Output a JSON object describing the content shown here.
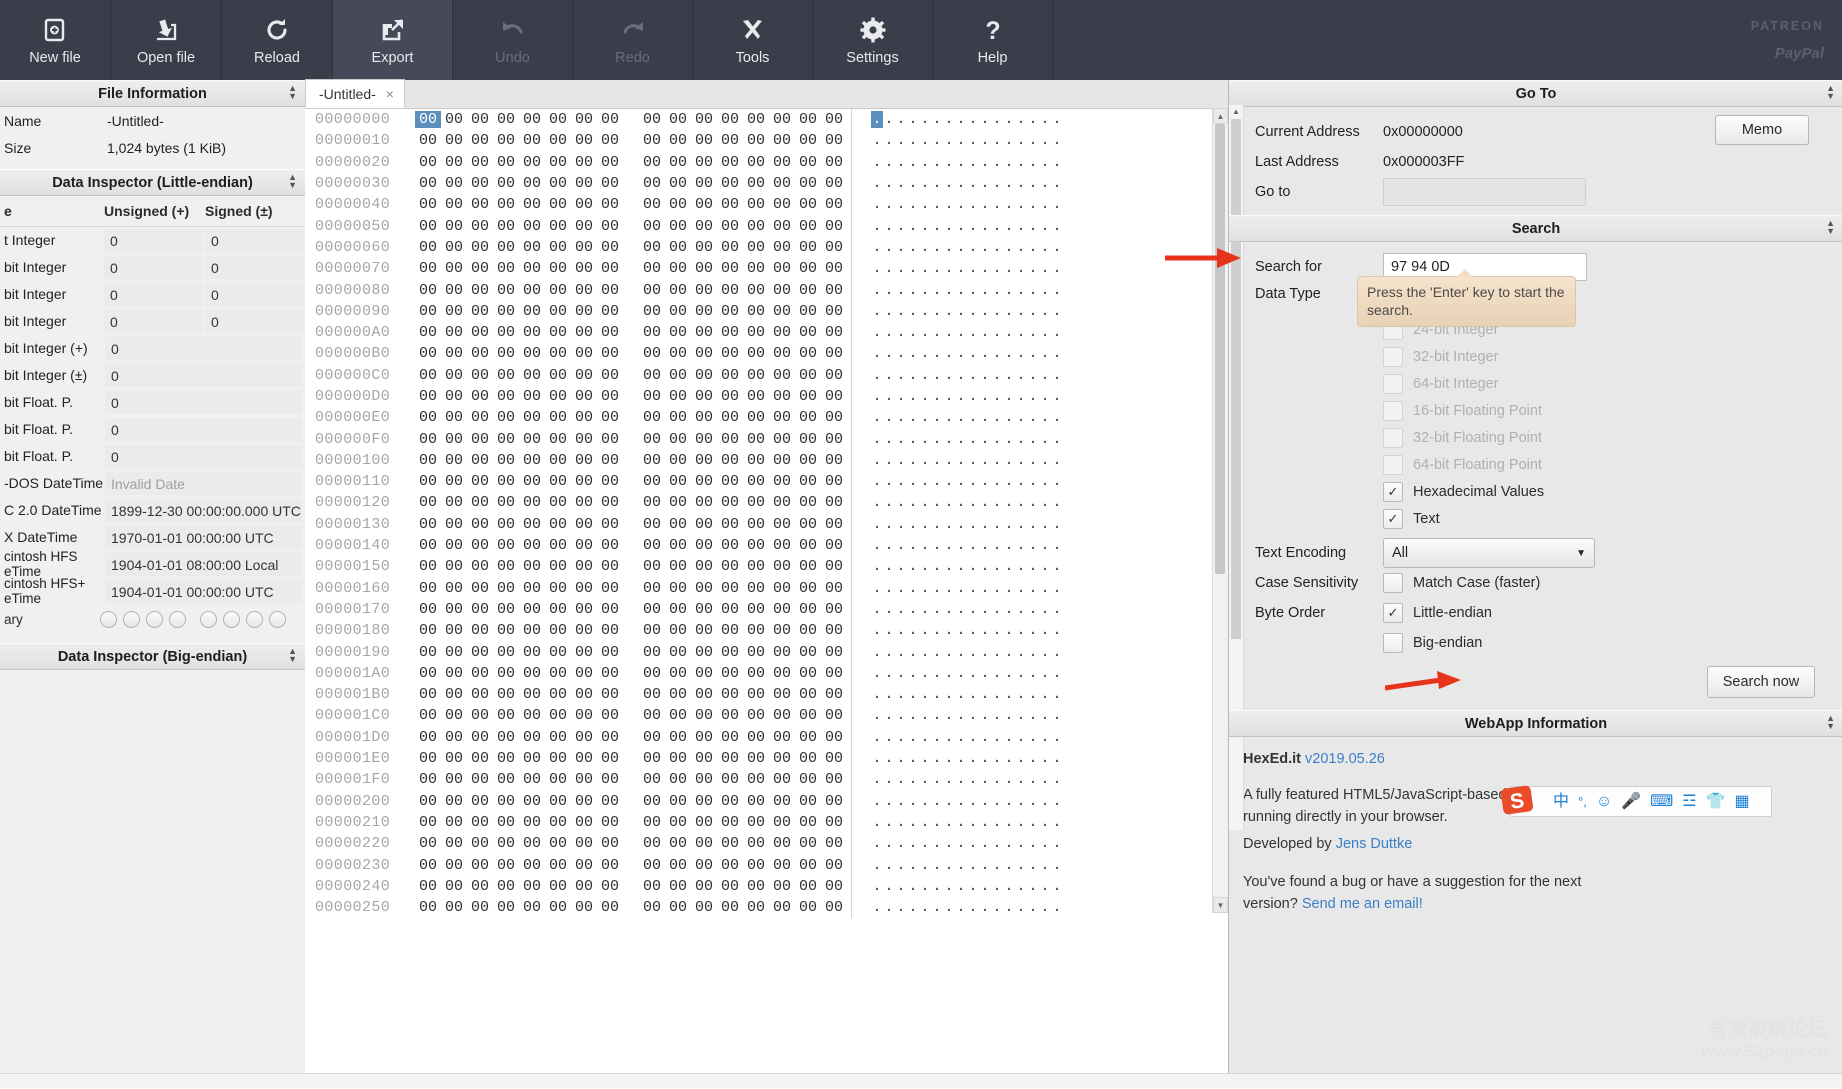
{
  "toolbar": {
    "buttons": [
      {
        "label": "New file",
        "icon": "new-file-icon",
        "state": "enabled"
      },
      {
        "label": "Open file",
        "icon": "open-file-icon",
        "state": "enabled"
      },
      {
        "label": "Reload",
        "icon": "reload-icon",
        "state": "enabled"
      },
      {
        "label": "Export",
        "icon": "export-icon",
        "state": "active"
      },
      {
        "label": "Undo",
        "icon": "undo-icon",
        "state": "disabled"
      },
      {
        "label": "Redo",
        "icon": "redo-icon",
        "state": "disabled"
      },
      {
        "label": "Tools",
        "icon": "tools-icon",
        "state": "enabled"
      },
      {
        "label": "Settings",
        "icon": "gear-icon",
        "state": "enabled"
      },
      {
        "label": "Help",
        "icon": "question-mark-icon",
        "state": "enabled"
      }
    ],
    "patreon": "PATREON",
    "paypal": "PayPal"
  },
  "left": {
    "file_information": {
      "title": "File Information",
      "rows": [
        {
          "key": "Name",
          "value": "-Untitled-"
        },
        {
          "key": "Size",
          "value": "1,024 bytes (1 KiB)"
        }
      ]
    },
    "data_inspector_le": {
      "title": "Data Inspector (Little-endian)",
      "columns": [
        "e",
        "Unsigned (+)",
        "Signed (±)"
      ],
      "rows": [
        {
          "label": "t Integer",
          "unsigned": "0",
          "signed": "0"
        },
        {
          "label": "bit Integer",
          "unsigned": "0",
          "signed": "0"
        },
        {
          "label": "bit Integer",
          "unsigned": "0",
          "signed": "0"
        },
        {
          "label": "bit Integer",
          "unsigned": "0",
          "signed": "0"
        },
        {
          "label": "bit Integer (+)",
          "unsigned": "0",
          "signed": null
        },
        {
          "label": "bit Integer (±)",
          "unsigned": "0",
          "signed": null
        },
        {
          "label": "bit Float. P.",
          "unsigned": "0",
          "signed": null
        },
        {
          "label": "bit Float. P.",
          "unsigned": "0",
          "signed": null
        },
        {
          "label": "bit Float. P.",
          "unsigned": "0",
          "signed": null
        },
        {
          "label": "-DOS DateTime",
          "unsigned": "Invalid Date",
          "signed": null,
          "placeholder": true
        },
        {
          "label": "C 2.0 DateTime",
          "unsigned": "1899-12-30 00:00:00.000 UTC",
          "signed": null
        },
        {
          "label": "X DateTime",
          "unsigned": "1970-01-01 00:00:00 UTC",
          "signed": null
        },
        {
          "label2a": "cintosh HFS",
          "label2b": "eTime",
          "unsigned": "1904-01-01 08:00:00 Local",
          "signed": null
        },
        {
          "label2a": "cintosh HFS+",
          "label2b": "eTime",
          "unsigned": "1904-01-01 00:00:00 UTC",
          "signed": null
        }
      ],
      "binary_row_label": "ary",
      "binary_bits": 8
    },
    "data_inspector_be": {
      "title": "Data Inspector (Big-endian)"
    }
  },
  "hex": {
    "tab": {
      "label": "-Untitled-",
      "close": "×"
    },
    "selected_offset": "00000000",
    "byte_value": "00",
    "ascii_char": ".",
    "bytes_per_row": 16,
    "offsets": [
      "00000000",
      "00000010",
      "00000020",
      "00000030",
      "00000040",
      "00000050",
      "00000060",
      "00000070",
      "00000080",
      "00000090",
      "000000A0",
      "000000B0",
      "000000C0",
      "000000D0",
      "000000E0",
      "000000F0",
      "00000100",
      "00000110",
      "00000120",
      "00000130",
      "00000140",
      "00000150",
      "00000160",
      "00000170",
      "00000180",
      "00000190",
      "000001A0",
      "000001B0",
      "000001C0",
      "000001D0",
      "000001E0",
      "000001F0",
      "00000200",
      "00000210",
      "00000220",
      "00000230",
      "00000240",
      "00000250"
    ]
  },
  "right": {
    "goto": {
      "title": "Go To",
      "current_address_label": "Current Address",
      "current_address_value": "0x00000000",
      "last_address_label": "Last Address",
      "last_address_value": "0x000003FF",
      "goto_label": "Go to",
      "goto_value": "",
      "memo_button": "Memo"
    },
    "search": {
      "title": "Search",
      "search_for_label": "Search for",
      "search_for_value": "97 94 0D",
      "data_type_label": "Data Type",
      "tooltip": "Press the 'Enter' key to start the search.",
      "data_types": [
        {
          "label": "24-bit Integer",
          "checked": false,
          "disabled": true
        },
        {
          "label": "32-bit Integer",
          "checked": false,
          "disabled": true
        },
        {
          "label": "64-bit Integer",
          "checked": false,
          "disabled": true
        },
        {
          "label": "16-bit Floating Point",
          "checked": false,
          "disabled": true
        },
        {
          "label": "32-bit Floating Point",
          "checked": false,
          "disabled": true
        },
        {
          "label": "64-bit Floating Point",
          "checked": false,
          "disabled": true
        },
        {
          "label": "Hexadecimal Values",
          "checked": true,
          "disabled": false
        },
        {
          "label": "Text",
          "checked": true,
          "disabled": false
        }
      ],
      "text_encoding_label": "Text Encoding",
      "text_encoding_value": "All",
      "case_sensitivity_label": "Case Sensitivity",
      "match_case_label": "Match Case (faster)",
      "match_case_checked": false,
      "byte_order_label": "Byte Order",
      "little_endian_label": "Little-endian",
      "little_endian_checked": true,
      "big_endian_label": "Big-endian",
      "big_endian_checked": false,
      "search_now_button": "Search now"
    },
    "webapp": {
      "title": "WebApp Information",
      "app_name": "HexEd.it",
      "version": "v2019.05.26",
      "description_line1": "A fully featured HTML5/JavaScript-based hex editor",
      "description_line2": "running directly in your browser.",
      "developed_by_prefix": "Developed by",
      "developer": "Jens Duttke",
      "bug_line1": "You've found a bug or have a suggestion for the next",
      "bug_line2_prefix": "version?",
      "bug_link": "Send me an email!"
    }
  },
  "ime": {
    "logo": "S",
    "icons": [
      "chinese-mode-icon",
      "punctuation-icon",
      "emoji-icon",
      "microphone-icon",
      "keyboard-icon",
      "user-card-icon",
      "skin-icon",
      "apps-icon"
    ]
  },
  "watermark": {
    "line1": "吾爱破解论坛",
    "line2": "www.52pojie.cn"
  },
  "colors": {
    "toolbar_bg": "#3a3d4a",
    "selection": "#5b90bd",
    "accent_link": "#3b7fc4",
    "annotation_arrow": "#e8331c"
  }
}
